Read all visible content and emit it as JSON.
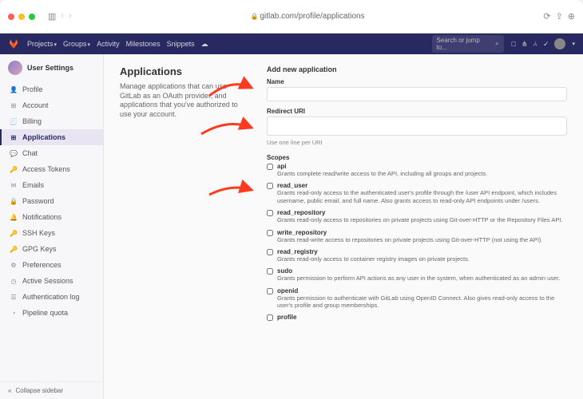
{
  "browser": {
    "url": "gitlab.com/profile/applications"
  },
  "topbar": {
    "menu": [
      "Projects",
      "Groups",
      "Activity",
      "Milestones",
      "Snippets"
    ],
    "search_placeholder": "Search or jump to..."
  },
  "sidebar": {
    "title": "User Settings",
    "items": [
      {
        "icon": "👤",
        "label": "Profile"
      },
      {
        "icon": "⊞",
        "label": "Account"
      },
      {
        "icon": "🧾",
        "label": "Billing"
      },
      {
        "icon": "⊞",
        "label": "Applications",
        "active": true
      },
      {
        "icon": "💬",
        "label": "Chat"
      },
      {
        "icon": "🔑",
        "label": "Access Tokens"
      },
      {
        "icon": "✉",
        "label": "Emails"
      },
      {
        "icon": "🔒",
        "label": "Password"
      },
      {
        "icon": "🔔",
        "label": "Notifications"
      },
      {
        "icon": "🔑",
        "label": "SSH Keys"
      },
      {
        "icon": "🔑",
        "label": "GPG Keys"
      },
      {
        "icon": "⚙",
        "label": "Preferences"
      },
      {
        "icon": "◷",
        "label": "Active Sessions"
      },
      {
        "icon": "☰",
        "label": "Authentication log"
      },
      {
        "icon": "◔",
        "label": "Pipeline quota"
      }
    ],
    "collapse": "Collapse sidebar"
  },
  "page": {
    "heading": "Applications",
    "description": "Manage applications that can use GitLab as an OAuth provider, and applications that you've authorized to use your account."
  },
  "form": {
    "title": "Add new application",
    "name_label": "Name",
    "redirect_label": "Redirect URI",
    "redirect_hint": "Use one line per URI",
    "scopes_label": "Scopes",
    "scopes": [
      {
        "name": "api",
        "desc": "Grants complete read/write access to the API, including all groups and projects."
      },
      {
        "name": "read_user",
        "desc": "Grants read-only access to the authenticated user's profile through the /user API endpoint, which includes username, public email, and full name. Also grants access to read-only API endpoints under /users."
      },
      {
        "name": "read_repository",
        "desc": "Grants read-only access to repositories on private projects using Git-over-HTTP or the Repository Files API."
      },
      {
        "name": "write_repository",
        "desc": "Grants read-write access to repositories on private projects using Git-over-HTTP (not using the API)."
      },
      {
        "name": "read_registry",
        "desc": "Grants read-only access to container registry images on private projects."
      },
      {
        "name": "sudo",
        "desc": "Grants permission to perform API actions as any user in the system, when authenticated as an admin user."
      },
      {
        "name": "openid",
        "desc": "Grants permission to authenticate with GitLab using OpenID Connect. Also gives read-only access to the user's profile and group memberships."
      },
      {
        "name": "profile",
        "desc": ""
      }
    ]
  }
}
